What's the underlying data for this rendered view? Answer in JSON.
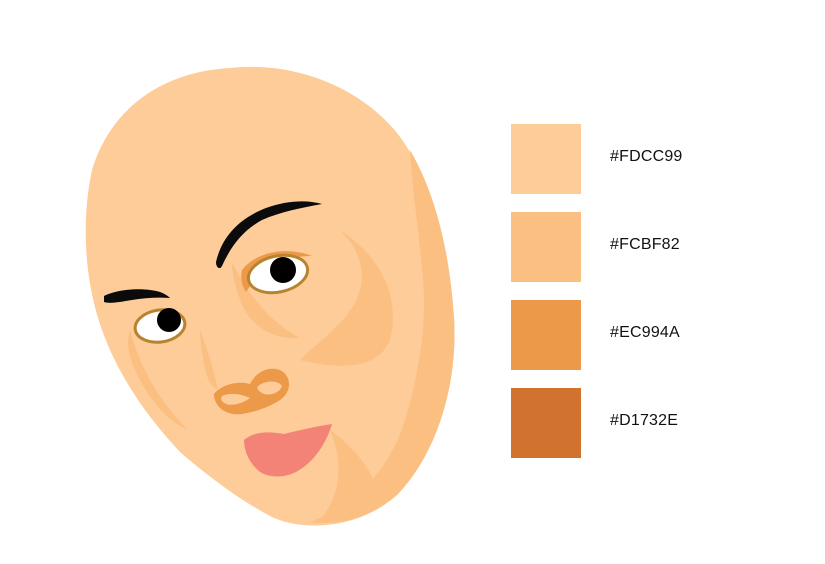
{
  "illustration": {
    "subject": "face-illustration",
    "colors": {
      "skin_base": "#FDCC99",
      "skin_shadow": "#FCBF82",
      "skin_mid": "#EC994A",
      "skin_dark": "#D1732E",
      "lips": "#F38377",
      "hair": "#0B0B0B",
      "eye_white": "#FFFFFF",
      "pupil": "#000000",
      "eye_outline": "#B8832F"
    }
  },
  "palette": {
    "swatches": [
      {
        "hex": "#FDCC99",
        "label": "#FDCC99"
      },
      {
        "hex": "#FCBF82",
        "label": "#FCBF82"
      },
      {
        "hex": "#EC994A",
        "label": "#EC994A"
      },
      {
        "hex": "#D1732E",
        "label": "#D1732E"
      }
    ]
  }
}
